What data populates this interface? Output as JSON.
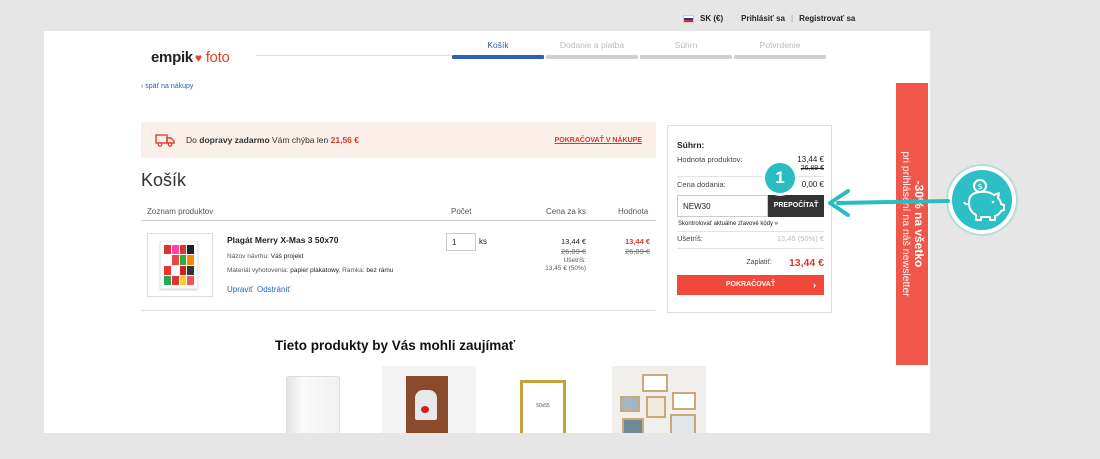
{
  "topbar": {
    "currency": "SK (€)",
    "login": "Prihlásiť sa",
    "separator": "|",
    "register": "Registrovať sa"
  },
  "logo": {
    "brand": "empik",
    "suffix": "foto"
  },
  "steps": [
    {
      "label": "Košík",
      "active": true
    },
    {
      "label": "Dodanie a platba",
      "active": false
    },
    {
      "label": "Súhrn",
      "active": false
    },
    {
      "label": "Potvrdenie",
      "active": false
    }
  ],
  "back_link": "‹ späť na nákupy",
  "free_shipping": {
    "prefix": "Do",
    "bold": "dopravy zadarmo",
    "middle": "Vám chýba len",
    "amount": "21,56 €",
    "continue": "POKRAČOVAŤ V NÁKUPE"
  },
  "cart": {
    "title": "Košík",
    "columns": {
      "products": "Zoznam produktov",
      "count": "Počet",
      "unit_price": "Cena za ks",
      "value": "Hodnota"
    },
    "items": [
      {
        "name": "Plagát Merry X-Mas 3 50x70",
        "design_label": "Názov návrhu:",
        "design_value": "Váš projekt",
        "material_label": "Materiál vyhotovenia:",
        "material_value": "papier plakatowy",
        "frame_label": ", Ramka:",
        "frame_value": "bez rámu",
        "edit": "Upraviť",
        "remove": "Odstrániť",
        "quantity": "1",
        "unit": "ks",
        "price_new": "13,44 €",
        "price_old": "26,89 €",
        "saved_label": "Ušetríš:",
        "saved_value": "13,45 € (50%)",
        "total_new": "13,44 €",
        "total_old": "26,89 €"
      }
    ]
  },
  "suggestions": {
    "title": "Tieto produkty by Vás mohli zaujímať"
  },
  "summary": {
    "title": "Súhrn:",
    "products_label": "Hodnota produktov:",
    "products_value": "13,44 €",
    "products_old": "26,89 €",
    "delivery_label": "Cena dodania:",
    "delivery_value": "0,00 €",
    "coupon_value": "NEW30",
    "recalc_button": "PREPOČÍTAŤ",
    "check_codes": "Skontrolovať aktuálne zľavové kódy »",
    "saved_label": "Ušetríš:",
    "saved_value": "13,45 (50%) €",
    "pay_label": "Zaplatiť:",
    "pay_value": "13,44 €",
    "continue_button": "POKRAČOVAŤ"
  },
  "annotation": {
    "badge": "1"
  },
  "promo": {
    "headline": "-30% na všetko",
    "subline": "pri prihlásení na náš newsletter"
  },
  "colors": {
    "accent": "#f0483a",
    "blue": "#2b62b5",
    "teal": "#2cc0c5"
  }
}
